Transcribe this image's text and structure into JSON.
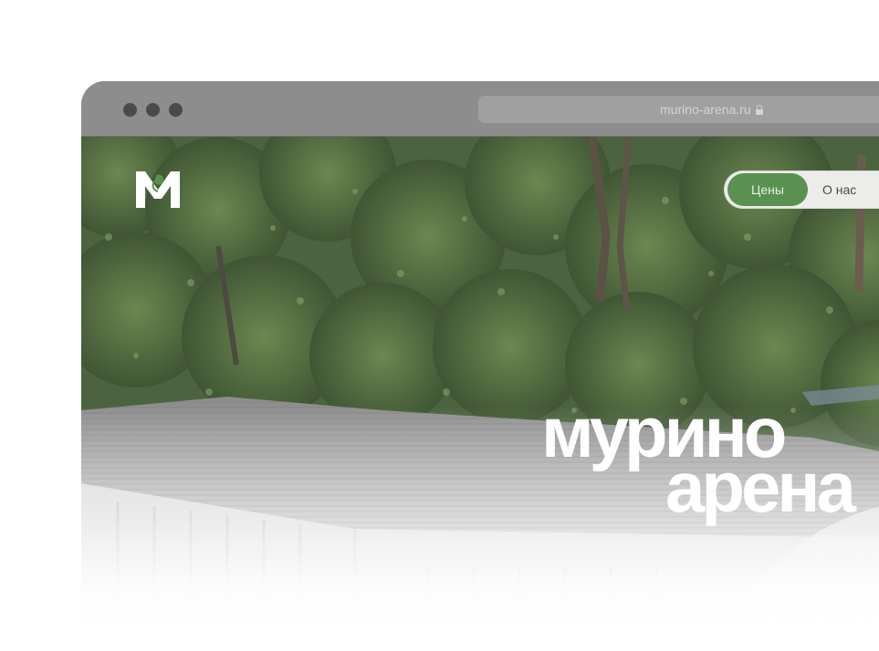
{
  "browser": {
    "url": "murino-arena.ru"
  },
  "brand": {
    "logo_letter": "M",
    "accent_color": "#5a9150"
  },
  "nav": {
    "items": [
      {
        "label": "Цены",
        "active": true
      },
      {
        "label": "О нас",
        "active": false
      }
    ]
  },
  "hero": {
    "title_line1": "мурино",
    "title_line2": "арена"
  }
}
